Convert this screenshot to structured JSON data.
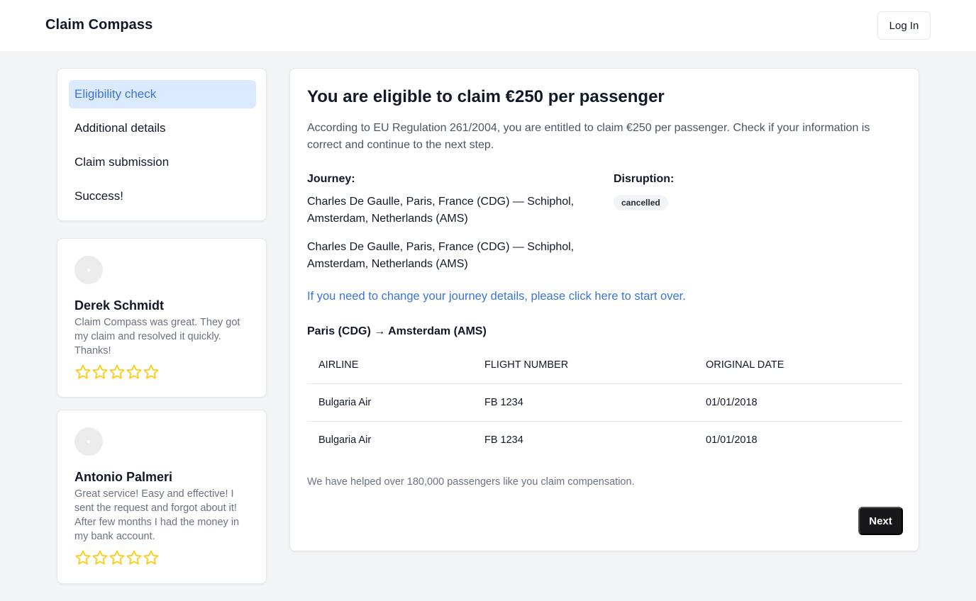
{
  "header": {
    "brand": "Claim Compass",
    "login_label": "Log In"
  },
  "steps": [
    {
      "label": "Eligibility check",
      "active": true
    },
    {
      "label": "Additional details",
      "active": false
    },
    {
      "label": "Claim submission",
      "active": false
    },
    {
      "label": "Success!",
      "active": false
    }
  ],
  "reviews": [
    {
      "name": "Derek Schmidt",
      "text": "Claim Compass was great. They got my claim and resolved it quickly. Thanks!",
      "stars": 5
    },
    {
      "name": "Antonio Palmeri",
      "text": "Great service! Easy and effective! I sent the request and forgot about it! After few months I had the money in my bank account.",
      "stars": 5
    }
  ],
  "main": {
    "title": "You are eligible to claim €250 per passenger",
    "intro": "According to EU Regulation 261/2004, you are entitled to claim €250 per passenger. Check if your information is correct and continue to the next step.",
    "journey_label": "Journey:",
    "journeys": [
      "Charles De Gaulle, Paris, France (CDG) — Schiphol, Amsterdam, Netherlands (AMS)",
      "Charles De Gaulle, Paris, France (CDG) — Schiphol, Amsterdam, Netherlands (AMS)"
    ],
    "disruption_label": "Disruption:",
    "disruption_badge": "cancelled",
    "change_link": "If you need to change your journey details, please click here to start over.",
    "route": "Paris (CDG) → Amsterdam (AMS)",
    "table": {
      "headers": [
        "AIRLINE",
        "FLIGHT NUMBER",
        "ORIGINAL DATE"
      ],
      "rows": [
        [
          "Bulgaria Air",
          "FB 1234",
          "01/01/2018"
        ],
        [
          "Bulgaria Air",
          "FB 1234",
          "01/01/2018"
        ]
      ]
    },
    "helped": "We have helped over 180,000 passengers like you claim compensation.",
    "next_label": "Next"
  },
  "colors": {
    "accent": "#3b74d4",
    "active_bg": "#dbeafe",
    "star": "#facc15",
    "button_dark": "#18181b"
  },
  "icons": {
    "rating": "star-outline-icon",
    "reviewer": "avatar-placeholder-icon"
  }
}
